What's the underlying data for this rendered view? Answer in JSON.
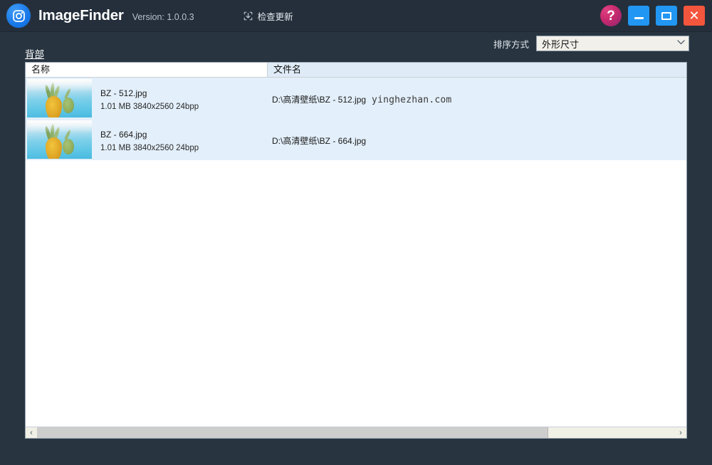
{
  "window": {
    "app_name": "ImageFinder",
    "version_label": "Version: 1.0.0.3",
    "check_update_label": "检查更新",
    "logo_icon": "camera-icon",
    "update_icon": "download-box-icon",
    "controls": {
      "help_label": "?",
      "help_icon": "question-mark-icon",
      "minimize_icon": "minimize-icon",
      "maximize_icon": "maximize-icon",
      "close_label": "✕",
      "close_icon": "close-icon"
    },
    "colors": {
      "titlebar_bg": "#242f3b",
      "window_bg": "#283541",
      "accent_blue": "#2196f3",
      "close_red": "#f4553d",
      "help_pink": "#c62a6e",
      "row_blue": "#e3effa",
      "header_blue": "#dfebf7"
    }
  },
  "toolbar": {
    "sort_label": "排序方式",
    "sort_value": "外形尺寸",
    "sort_caret": "⌄",
    "back_link": "背部"
  },
  "list": {
    "columns": [
      {
        "key": "name",
        "label": "名称"
      },
      {
        "key": "filename",
        "label": "文件名"
      }
    ],
    "rows": [
      {
        "name": "BZ - 512.jpg",
        "info": "1.01 MB  3840x2560  24bpp",
        "size": "1.01 MB",
        "dimensions": "3840x2560",
        "depth": "24bpp",
        "path": "D:\\高清壁纸\\BZ - 512.jpg",
        "watermark": "yinghezhan.com",
        "thumbnail": "pineapple-thumbnail"
      },
      {
        "name": "BZ - 664.jpg",
        "info": "1.01 MB  3840x2560  24bpp",
        "size": "1.01 MB",
        "dimensions": "3840x2560",
        "depth": "24bpp",
        "path": "D:\\高清壁纸\\BZ - 664.jpg",
        "watermark": "",
        "thumbnail": "pineapple-thumbnail"
      }
    ]
  },
  "scrollbar": {
    "left_arrow": "‹",
    "right_arrow": "›",
    "thumb_percent": "80%"
  }
}
